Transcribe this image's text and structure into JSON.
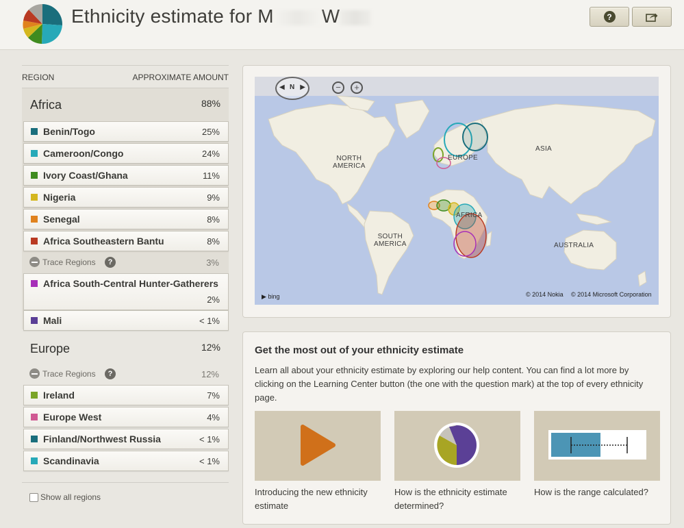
{
  "header": {
    "title_prefix": "Ethnicity estimate for M",
    "title_suffix": "W",
    "help_label": "?"
  },
  "table_header": {
    "region": "REGION",
    "amount": "APPROXIMATE AMOUNT"
  },
  "africa": {
    "name": "Africa",
    "percent": "88%",
    "regions": [
      {
        "name": "Benin/Togo",
        "percent": "25%",
        "color": "#1a6e7c"
      },
      {
        "name": "Cameroon/Congo",
        "percent": "24%",
        "color": "#27a9b8"
      },
      {
        "name": "Ivory Coast/Ghana",
        "percent": "11%",
        "color": "#3f8b1f"
      },
      {
        "name": "Nigeria",
        "percent": "9%",
        "color": "#d4b71f"
      },
      {
        "name": "Senegal",
        "percent": "8%",
        "color": "#e0821e"
      },
      {
        "name": "Africa Southeastern Bantu",
        "percent": "8%",
        "color": "#b93a22"
      }
    ],
    "trace": {
      "label": "Trace Regions",
      "percent": "3%"
    },
    "trace_regions": [
      {
        "name": "Africa South-Central Hunter-Gatherers",
        "percent": "2%",
        "color": "#a62fb8"
      },
      {
        "name": "Mali",
        "percent": "< 1%",
        "color": "#5a3f96"
      }
    ]
  },
  "europe": {
    "name": "Europe",
    "percent": "12%",
    "trace": {
      "label": "Trace Regions",
      "percent": "12%"
    },
    "regions": [
      {
        "name": "Ireland",
        "percent": "7%",
        "color": "#7ba428"
      },
      {
        "name": "Europe West",
        "percent": "4%",
        "color": "#d05a93"
      },
      {
        "name": "Finland/Northwest Russia",
        "percent": "< 1%",
        "color": "#1a6e7c"
      },
      {
        "name": "Scandinavia",
        "percent": "< 1%",
        "color": "#27a9b8"
      }
    ]
  },
  "show_all": "Show all regions",
  "map": {
    "nav_n": "N",
    "labels": {
      "north_america": "NORTH\nAMERICA",
      "south_america": "SOUTH\nAMERICA",
      "europe": "EUROPE",
      "asia": "ASIA",
      "africa": "AFRICA",
      "australia": "AUSTRALIA"
    },
    "bing": "bing",
    "copyright_nokia": "© 2014 Nokia",
    "copyright_ms": "© 2014 Microsoft Corporation"
  },
  "info": {
    "title": "Get the most out of your ethnicity estimate",
    "body": "Learn all about your ethnicity estimate by exploring our help content. You can find a lot more by clicking on the Learning Center button (the one with the question mark) at the top of every ethnicity page.",
    "cards": [
      {
        "caption": "Introducing the new ethnicity estimate",
        "icon": "play-icon"
      },
      {
        "caption": "How is the ethnicity estimate determined?",
        "icon": "pie-chart-icon"
      },
      {
        "caption": "How is the range calculated?",
        "icon": "range-bar-icon"
      }
    ]
  }
}
